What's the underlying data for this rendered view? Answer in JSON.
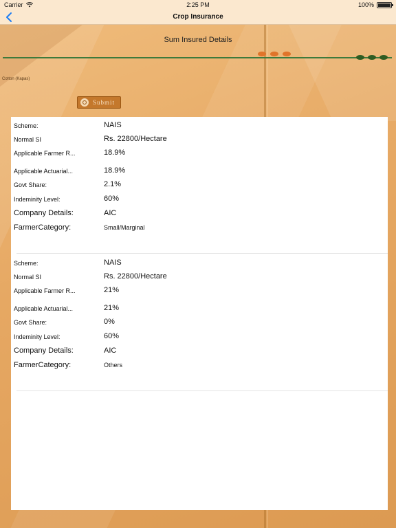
{
  "status_bar": {
    "carrier": "Carrier",
    "time": "2:25 PM",
    "battery": "100%"
  },
  "nav": {
    "title": "Crop Insurance"
  },
  "section": {
    "title": "Sum Insured Details"
  },
  "crop": {
    "label": "Cotton (Kapas)"
  },
  "submit": {
    "label": "Submit"
  },
  "records": [
    {
      "scheme_label": "Scheme:",
      "scheme": "NAIS",
      "normal_si_label": "Normal SI",
      "normal_si": "Rs. 22800/Hectare",
      "farmer_rate_label": "Applicable Farmer R...",
      "farmer_rate": "18.9%",
      "actuarial_label": "Applicable Actuarial...",
      "actuarial": "18.9%",
      "govt_share_label": "Govt Share:",
      "govt_share": "2.1%",
      "indemnity_label": "Indeminity Level:",
      "indemnity": "60%",
      "company_label": "Company Details:",
      "company": "AIC",
      "farmer_category_label": "FarmerCategory:",
      "farmer_category": "Small/Marginal"
    },
    {
      "scheme_label": "Scheme:",
      "scheme": "NAIS",
      "normal_si_label": "Normal SI",
      "normal_si": "Rs. 22800/Hectare",
      "farmer_rate_label": "Applicable Farmer R...",
      "farmer_rate": "21%",
      "actuarial_label": "Applicable Actuarial...",
      "actuarial": "21%",
      "govt_share_label": "Govt Share:",
      "govt_share": "0%",
      "indemnity_label": "Indeminity Level:",
      "indemnity": "60%",
      "company_label": "Company Details:",
      "company": "AIC",
      "farmer_category_label": "FarmerCategory:",
      "farmer_category": "Others"
    }
  ],
  "icons": {
    "back": "chevron-left-icon",
    "wifi": "wifi-icon",
    "battery": "battery-icon",
    "submit": "search-icon"
  },
  "colors": {
    "accent_blue": "#1a7cf5",
    "slider_green": "#3e7a3c",
    "dot_orange": "#e0742a",
    "button_brown": "#c4782c"
  }
}
